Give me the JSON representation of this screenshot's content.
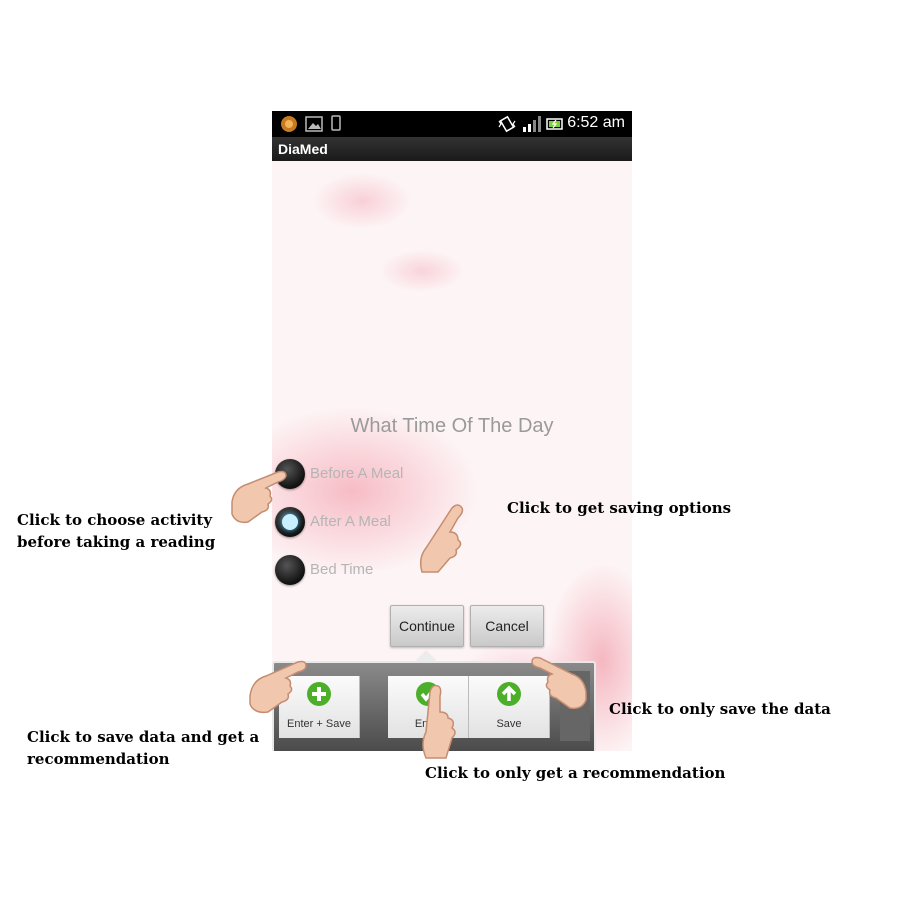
{
  "status_bar": {
    "time": "6:52 am",
    "notification_icons": [
      "record-icon",
      "image-icon",
      "phone-icon"
    ],
    "status_icons": [
      "vibrate-icon",
      "signal-icon",
      "battery-icon"
    ]
  },
  "app": {
    "title": "DiaMed"
  },
  "form": {
    "question": "What Time Of The Day",
    "options": [
      {
        "label": "Before A Meal",
        "checked": false
      },
      {
        "label": "After A Meal",
        "checked": true
      },
      {
        "label": "Bed Time",
        "checked": false
      }
    ],
    "continue_label": "Continue",
    "cancel_label": "Cancel"
  },
  "popup": {
    "actions": [
      {
        "label": "Enter + Save",
        "icon": "plus-icon",
        "color": "#4caf2a"
      },
      {
        "label": "Enter",
        "icon": "check-icon",
        "color": "#4caf2a"
      },
      {
        "label": "Save",
        "icon": "up-arrow-icon",
        "color": "#4caf2a"
      }
    ]
  },
  "annotations": {
    "choose_activity": [
      "Click to choose activity",
      "before taking a reading"
    ],
    "saving_options": "Click to get saving options",
    "only_save": "Click to only save the data",
    "save_and_recommend": [
      "Click to save data and get a",
      "recommendation"
    ],
    "only_recommend": "Click to only get a recommendation"
  }
}
